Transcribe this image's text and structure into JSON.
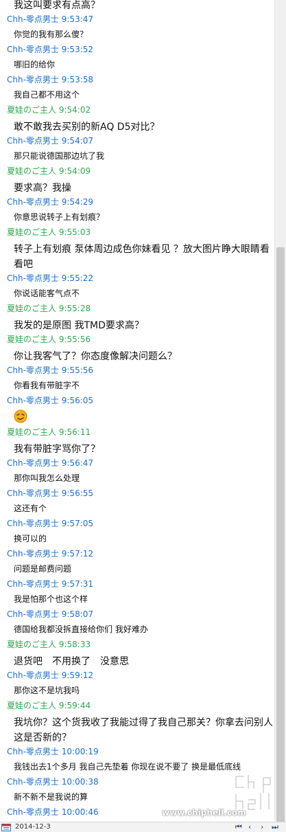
{
  "messages": [
    {
      "type": "text",
      "size": "big",
      "text": "我这叫要求有点高？"
    },
    {
      "type": "header",
      "color": "blue",
      "sender": "Chh-零点男士",
      "time": "9:53:47"
    },
    {
      "type": "text",
      "size": "small",
      "text": "你觉的我有那么傻？"
    },
    {
      "type": "header",
      "color": "blue",
      "sender": "Chh-零点男士",
      "time": "9:53:52"
    },
    {
      "type": "text",
      "size": "small",
      "text": "哪旧的给你"
    },
    {
      "type": "header",
      "color": "blue",
      "sender": "Chh-零点男士",
      "time": "9:53:58"
    },
    {
      "type": "text",
      "size": "small",
      "text": "我自己都不用这个"
    },
    {
      "type": "header",
      "color": "green",
      "sender": "夏娃のご主人",
      "time": "9:54:02"
    },
    {
      "type": "text",
      "size": "big",
      "text": "敢不敢我去买别的新AQ D5对比？"
    },
    {
      "type": "header",
      "color": "blue",
      "sender": "Chh-零点男士",
      "time": "9:54:07"
    },
    {
      "type": "text",
      "size": "small",
      "text": "那只能说德国那边坑了我"
    },
    {
      "type": "header",
      "color": "green",
      "sender": "夏娃のご主人",
      "time": "9:54:09"
    },
    {
      "type": "text",
      "size": "big",
      "text": "要求高？我操"
    },
    {
      "type": "header",
      "color": "blue",
      "sender": "Chh-零点男士",
      "time": "9:54:29"
    },
    {
      "type": "text",
      "size": "small",
      "text": "你意思说转子上有划痕？"
    },
    {
      "type": "header",
      "color": "green",
      "sender": "夏娃のご主人",
      "time": "9:55:03"
    },
    {
      "type": "text",
      "size": "big",
      "text": "转子上有划痕 泵体周边成色你妹看见 ？放大图片睁大眼睛看看吧"
    },
    {
      "type": "header",
      "color": "blue",
      "sender": "Chh-零点男士",
      "time": "9:55:22"
    },
    {
      "type": "text",
      "size": "small",
      "text": "你说话能客气点不"
    },
    {
      "type": "header",
      "color": "green",
      "sender": "夏娃のご主人",
      "time": "9:55:28"
    },
    {
      "type": "text",
      "size": "big",
      "text": "我发的是原图 我TMD要求高？"
    },
    {
      "type": "header",
      "color": "green",
      "sender": "夏娃のご主人",
      "time": "9:55:56"
    },
    {
      "type": "text",
      "size": "big",
      "text": "你让我客气了？你态度像解决问题么？"
    },
    {
      "type": "header",
      "color": "blue",
      "sender": "Chh-零点男士",
      "time": "9:55:56"
    },
    {
      "type": "text",
      "size": "small",
      "text": "你看我有带脏字不"
    },
    {
      "type": "header",
      "color": "blue",
      "sender": "Chh-零点男士",
      "time": "9:56:05"
    },
    {
      "type": "emoji",
      "icon": "smirk-emoji-icon"
    },
    {
      "type": "header",
      "color": "green",
      "sender": "夏娃のご主人",
      "time": "9:56:11"
    },
    {
      "type": "text",
      "size": "big",
      "text": "我有带脏字骂你了？"
    },
    {
      "type": "header",
      "color": "blue",
      "sender": "Chh-零点男士",
      "time": "9:56:47"
    },
    {
      "type": "text",
      "size": "small",
      "text": "那你叫我怎么处理"
    },
    {
      "type": "header",
      "color": "blue",
      "sender": "Chh-零点男士",
      "time": "9:56:55"
    },
    {
      "type": "text",
      "size": "small",
      "text": "这还有个"
    },
    {
      "type": "header",
      "color": "blue",
      "sender": "Chh-零点男士",
      "time": "9:57:05"
    },
    {
      "type": "text",
      "size": "small",
      "text": "换可以的"
    },
    {
      "type": "header",
      "color": "blue",
      "sender": "Chh-零点男士",
      "time": "9:57:12"
    },
    {
      "type": "text",
      "size": "small",
      "text": "问题是邮费问题"
    },
    {
      "type": "header",
      "color": "blue",
      "sender": "Chh-零点男士",
      "time": "9:57:31"
    },
    {
      "type": "text",
      "size": "small",
      "text": "我是怕那个也这个样"
    },
    {
      "type": "header",
      "color": "blue",
      "sender": "Chh-零点男士",
      "time": "9:58:07"
    },
    {
      "type": "text",
      "size": "small",
      "text": "德国给我都没拆直接给你们 我好难办"
    },
    {
      "type": "header",
      "color": "green",
      "sender": "夏娃のご主人",
      "time": "9:58:33"
    },
    {
      "type": "text",
      "size": "big",
      "text": "退货吧　不用换了　没意思"
    },
    {
      "type": "header",
      "color": "blue",
      "sender": "Chh-零点男士",
      "time": "9:59:12"
    },
    {
      "type": "text",
      "size": "small",
      "text": "那你这不是坑我吗"
    },
    {
      "type": "header",
      "color": "green",
      "sender": "夏娃のご主人",
      "time": "9:59:44"
    },
    {
      "type": "text",
      "size": "big",
      "text": "我坑你？这个货我收了我能过得了我自己那关？你拿去问别人这是否新的？"
    },
    {
      "type": "header",
      "color": "blue",
      "sender": "Chh-零点男士",
      "time": "10:00:19"
    },
    {
      "type": "text",
      "size": "small",
      "text": "我钱出去1个多月 我自己先垫着 你现在说不要了  换是最低底线"
    },
    {
      "type": "header",
      "color": "blue",
      "sender": "Chh-零点男士",
      "time": "10:00:38"
    },
    {
      "type": "text",
      "size": "small",
      "text": "新不新不是我说的算"
    },
    {
      "type": "header",
      "color": "blue",
      "sender": "Chh-零点男士",
      "time": "10:00:46"
    }
  ],
  "statusbar": {
    "date": "2014-12-3",
    "nav_first": "⏮",
    "nav_prev": "‹",
    "nav_next": "›",
    "nav_last": "⏭"
  },
  "watermark": {
    "url": "www.chiphell.com",
    "logo_text": "chip hell"
  }
}
